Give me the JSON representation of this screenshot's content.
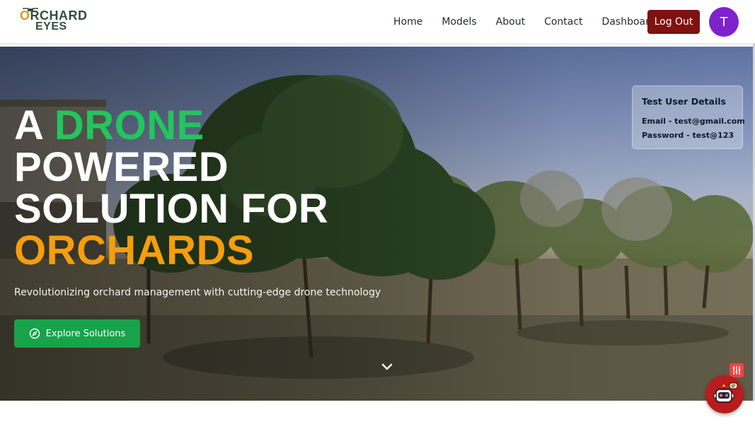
{
  "logo": {
    "line1": "ORCHARD",
    "line2": "EYES"
  },
  "nav": {
    "items": [
      {
        "label": "Home"
      },
      {
        "label": "Models"
      },
      {
        "label": "About"
      },
      {
        "label": "Contact"
      },
      {
        "label": "Dashboard"
      }
    ],
    "logout_label": "Log Out",
    "avatar_initial": "T"
  },
  "hero": {
    "headline": {
      "word_a": "A",
      "word_drone": "DRONE",
      "line2": "POWERED",
      "line3": "SOLUTION FOR",
      "line4": "ORCHARDS"
    },
    "subtitle": "Revolutionizing orchard management with cutting-edge drone technology",
    "cta_label": "Explore Solutions",
    "cta_icon": "compass-icon",
    "scroll_icon": "chevron-down-icon"
  },
  "test_user": {
    "title": "Test User Details",
    "email": "Email - test@gmail.com",
    "password": "Password - test@123"
  },
  "widgets": {
    "settings_icon": "sliders-icon",
    "chatbot_icon": "robot-icon"
  },
  "colors": {
    "accent_green": "#22c55e",
    "accent_orange": "#f59e0b",
    "logout_bg": "#7f1111",
    "avatar_bg": "#7e22ce",
    "cta_bg": "#16a34a"
  }
}
